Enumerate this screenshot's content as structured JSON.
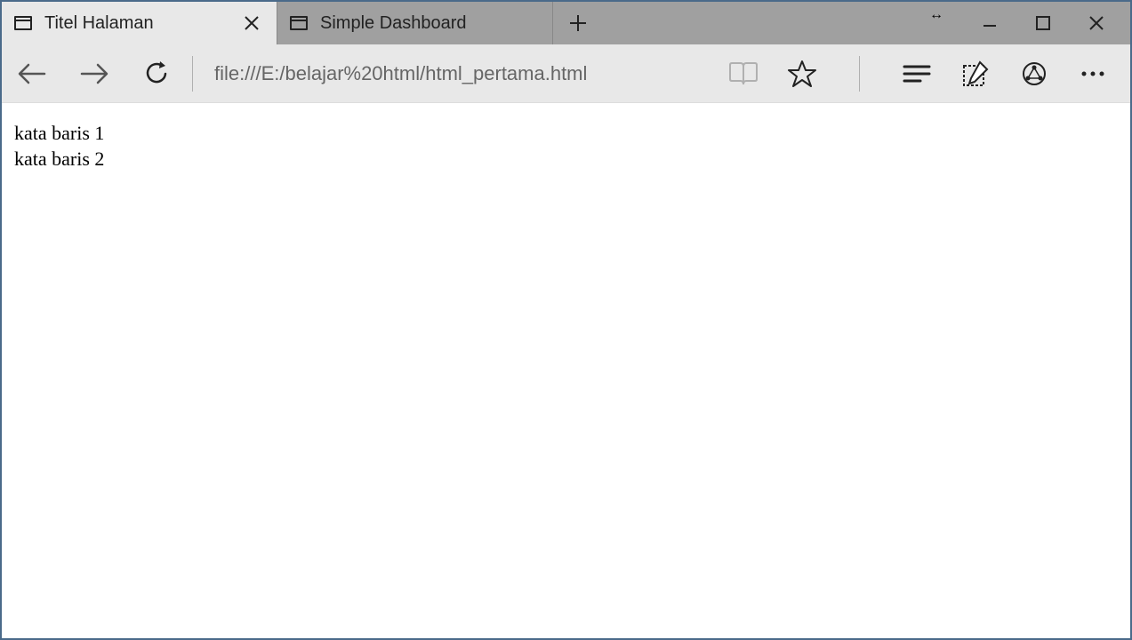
{
  "tabs": [
    {
      "title": "Titel Halaman",
      "active": true
    },
    {
      "title": "Simple Dashboard",
      "active": false
    }
  ],
  "address": "file:///E:/belajar%20html/html_pertama.html",
  "page": {
    "lines": [
      "kata baris 1",
      "kata baris 2"
    ]
  }
}
